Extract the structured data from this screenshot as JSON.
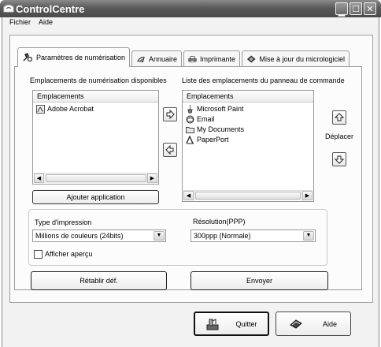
{
  "window": {
    "title": "ControlCentre"
  },
  "menu": [
    {
      "label": "Fichier"
    },
    {
      "label": "Aide"
    }
  ],
  "tabs": [
    {
      "label": "Paramètres de numérisation",
      "icon": "scanner-settings-icon",
      "active": true
    },
    {
      "label": "Annuaire",
      "icon": "address-book-icon"
    },
    {
      "label": "Imprimante",
      "icon": "printer-icon"
    },
    {
      "label": "Mise à jour du micrologiciel",
      "icon": "firmware-update-icon"
    }
  ],
  "scan": {
    "available_label": "Emplacements de numérisation disponibles",
    "panel_list_label": "Liste des emplacements du panneau de commande",
    "available_header": "Emplacements",
    "available_items": [
      {
        "label": "Adobe Acrobat",
        "icon": "adobe-acrobat-icon"
      }
    ],
    "panel_header": "Emplacements",
    "panel_items": [
      {
        "label": "Microsoft Paint",
        "icon": "paint-brush-icon"
      },
      {
        "label": "Email",
        "icon": "email-icon"
      },
      {
        "label": "My Documents",
        "icon": "folder-icon"
      },
      {
        "label": "PaperPort",
        "icon": "paperport-icon"
      }
    ],
    "move_label": "Déplacer",
    "add_app_label": "Ajouter application"
  },
  "print": {
    "type_label": "Type d'impression",
    "type_value": "Millions de couleurs (24bits)",
    "resolution_label": "Résolution(PPP)",
    "resolution_value": "300ppp (Normale)",
    "preview_label": "Afficher aperçu",
    "preview_checked": false
  },
  "actions": {
    "reset_label": "Rétablir déf.",
    "send_label": "Envoyer"
  },
  "footer": {
    "quit_label": "Quitter",
    "help_label": "Aide"
  }
}
